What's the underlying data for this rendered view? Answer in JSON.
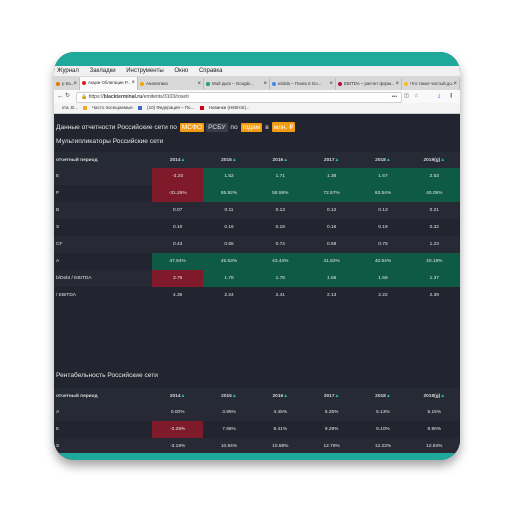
{
  "colors": {
    "accent": "#1ea99c",
    "positive": "#0f5a45",
    "negative": "#7e1a2a",
    "orange": "#f39c12"
  },
  "menu": [
    "Журнал",
    "Закладки",
    "Инструменты",
    "Окно",
    "Справка"
  ],
  "tabs": [
    {
      "label": "р Ка...",
      "active": false
    },
    {
      "label": "Акции Облигации Р...",
      "active": true
    },
    {
      "label": "Аналитика",
      "active": false
    },
    {
      "label": "Мой диск – Google...",
      "active": false
    },
    {
      "label": "ebitda – Поиск в Go...",
      "active": false
    },
    {
      "label": "EBITDA – расчет форм...",
      "active": false
    },
    {
      "label": "Что такое чистый до...",
      "active": false
    }
  ],
  "url": {
    "prefix": "https://",
    "host": "blackterminal.ru",
    "path": "/emitents/3103/roseti",
    "more": "•••"
  },
  "bookmarks": [
    "кта. В...",
    "Часто посещаемые",
    "(10) Федерация – По...",
    "Новинки (Н60Н3r)..."
  ],
  "heading": {
    "prefix": "Данные отчетности Российские сети по",
    "std1": "МСФО",
    "std2": "РСБУ",
    "by": "по",
    "period": "годам",
    "in": "в",
    "unit": "млн. ₽"
  },
  "multipliers": {
    "title": "Мультипликаторы Российские сети",
    "period_label": "отчетный период",
    "years": [
      "2014",
      "2015",
      "2016",
      "2017",
      "2018",
      "2019(g)"
    ],
    "rows": [
      {
        "label": "E",
        "values": [
          "-3.20",
          "1.52",
          "1.71",
          "1.38",
          "1.67",
          "2.53"
        ],
        "states": [
          "neg",
          "pos",
          "pos",
          "pos",
          "pos",
          "pos"
        ]
      },
      {
        "label": "P",
        "values": [
          "-31.26%",
          "65.92%",
          "58.59%",
          "72.57%",
          "63.54%",
          "40.05%"
        ],
        "states": [
          "neg",
          "pos",
          "pos",
          "pos",
          "pos",
          "pos"
        ]
      },
      {
        "label": "B",
        "values": [
          "0.07",
          "0.11",
          "0.13",
          "0.12",
          "0.13",
          "0.21"
        ],
        "states": [
          "",
          "",
          "",
          "",
          "",
          ""
        ]
      },
      {
        "label": "S",
        "values": [
          "0.10",
          "0.16",
          "0.18",
          "0.16",
          "0.19",
          "0.32"
        ],
        "states": [
          "",
          "",
          "",
          "",
          "",
          ""
        ]
      },
      {
        "label": "CF",
        "values": [
          "0.43",
          "0.65",
          "0.74",
          "0.68",
          "0.78",
          "1.23"
        ],
        "states": [
          "",
          "",
          "",
          "",
          "",
          ""
        ]
      },
      {
        "label": "A",
        "values": [
          "47.64%",
          "45.53%",
          "43.44%",
          "41.82%",
          "40.64%",
          "40.19%"
        ],
        "states": [
          "pos",
          "pos",
          "pos",
          "pos",
          "pos",
          "pos"
        ]
      },
      {
        "label": "b/Debt / EBITDA",
        "values": [
          "3.76",
          "1.78",
          "1.78",
          "1.56",
          "1.58",
          "1.37"
        ],
        "states": [
          "neg",
          "pos",
          "pos",
          "pos",
          "pos",
          "pos"
        ]
      },
      {
        "label": "/ EBITDA",
        "values": [
          "4.35",
          "2.24",
          "2.41",
          "2.13",
          "2.22",
          "2.39"
        ],
        "states": [
          "",
          "",
          "",
          "",
          "",
          ""
        ]
      }
    ]
  },
  "profitability": {
    "title": "Рентабельность Российские сети",
    "period_label": "отчетный период",
    "years": [
      "2014",
      "2015",
      "2016",
      "2017",
      "2018",
      "2019(g)"
    ],
    "rows": [
      {
        "label": "A",
        "values": [
          "0.00%",
          "3.95%",
          "4.45%",
          "5.25%",
          "5.13%",
          "5.15%"
        ],
        "states": [
          "",
          "",
          "",
          "",
          "",
          ""
        ]
      },
      {
        "label": "E",
        "values": [
          "-2.28%",
          "7.86%",
          "8.41%",
          "9.29%",
          "9.10%",
          "8.90%"
        ],
        "states": [
          "neg",
          "",
          "",
          "",
          "",
          ""
        ]
      },
      {
        "label": "S",
        "values": [
          "-3.19%",
          "10.84%",
          "10.68%",
          "12.78%",
          "12.23%",
          "12.84%"
        ],
        "states": [
          "",
          "",
          "",
          "",
          "",
          ""
        ]
      }
    ]
  }
}
